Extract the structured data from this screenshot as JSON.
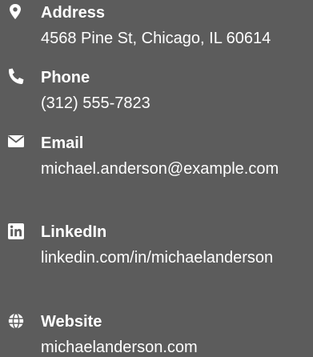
{
  "contact": {
    "items": [
      {
        "label": "Address",
        "value": "4568 Pine St, Chicago, IL 60614",
        "icon": "map-marker-icon"
      },
      {
        "label": "Phone",
        "value": "(312) 555-7823",
        "icon": "phone-icon"
      },
      {
        "label": "Email",
        "value": "michael.anderson@example.com",
        "icon": "envelope-icon"
      },
      {
        "label": "LinkedIn",
        "value": "linkedin.com/in/michaelanderson",
        "icon": "linkedin-icon"
      },
      {
        "label": "Website",
        "value": "michaelanderson.com",
        "icon": "globe-icon"
      }
    ]
  },
  "colors": {
    "background": "#5c5c5c",
    "text": "#ffffff"
  }
}
